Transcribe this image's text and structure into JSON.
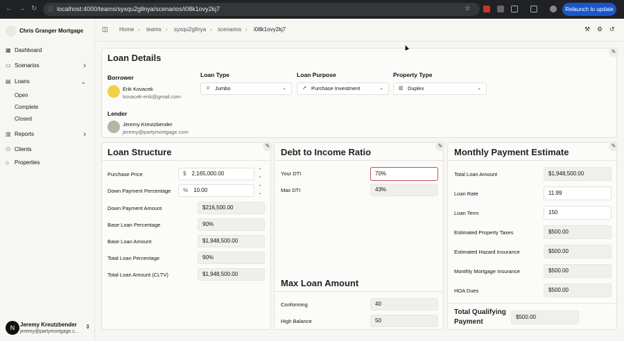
{
  "browser": {
    "url": "localhost:4000/teams/syxqu2gllnya/scenarios/i08k1ovy2kj7",
    "relaunch_label": "Relaunch to update"
  },
  "sidebar": {
    "org_name": "Chris Granger Mortgage",
    "items": [
      {
        "label": "Dashboard",
        "icon": "grid-icon"
      },
      {
        "label": "Scenarios",
        "icon": "file-icon"
      },
      {
        "label": "Loans",
        "icon": "document-icon"
      },
      {
        "label": "Reports",
        "icon": "chart-icon"
      },
      {
        "label": "Clients",
        "icon": "users-icon"
      },
      {
        "label": "Properties",
        "icon": "home-icon"
      }
    ],
    "loan_subitems": [
      "Open",
      "Complete",
      "Closed"
    ],
    "user": {
      "initial": "N",
      "name": "Jeremy Kreutzbender",
      "email": "jeremy@partymortgage.c..."
    }
  },
  "breadcrumb": [
    "Home",
    "teams",
    "syxqu2gllnya",
    "scenarios",
    "i08k1ovy2kj7"
  ],
  "loan_details": {
    "title": "Loan Details",
    "borrower_label": "Borrower",
    "borrower_name": "Erik Kovacek",
    "borrower_email": "kovacek-erik@gmail.com",
    "lender_label": "Lender",
    "lender_name": "Jeremy Kreutzbender",
    "lender_email": "jeremy@partymortgage.com",
    "loan_type_label": "Loan Type",
    "loan_type": "Jumbo",
    "loan_purpose_label": "Loan Purpose",
    "loan_purpose": "Purchase Investment",
    "property_type_label": "Property Type",
    "property_type": "Duplex"
  },
  "loan_structure": {
    "title": "Loan Structure",
    "purchase_price_label": "Purchase Price",
    "purchase_price_prefix": "$",
    "purchase_price": "2,165,000.00",
    "down_payment_pct_label": "Down Payment Percentage",
    "down_payment_pct_prefix": "%",
    "down_payment_pct": "10.00",
    "rows": [
      {
        "label": "Down Payment Amount",
        "value": "$216,500.00"
      },
      {
        "label": "Base Loan Percentage",
        "value": "90%"
      },
      {
        "label": "Base Loan Amount",
        "value": "$1,948,500.00"
      },
      {
        "label": "Total Loan Percentage",
        "value": "90%"
      },
      {
        "label": "Total Loan Amount (CLTV)",
        "value": "$1,948,500.00"
      }
    ]
  },
  "dti": {
    "title": "Debt to Income Ratio",
    "your_dti_label": "Your DTI",
    "your_dti": "70%",
    "max_dti_label": "Max DTI",
    "max_dti": "43%"
  },
  "max_loan": {
    "title": "Max Loan Amount",
    "conforming_label": "Conforming",
    "conforming": "40",
    "high_balance_label": "High Balance",
    "high_balance": "50"
  },
  "monthly": {
    "title": "Monthly Payment Estimate",
    "rows": [
      {
        "label": "Total Loan Amount",
        "value": "$1,948,500.00",
        "readonly": true
      },
      {
        "label": "Loan Rate",
        "value": "11.99",
        "readonly": false
      },
      {
        "label": "Loan Term",
        "value": "150",
        "readonly": false
      },
      {
        "label": "Estimated Property Taxes",
        "value": "$500.00",
        "readonly": true
      },
      {
        "label": "Estimated Hazard Insurance",
        "value": "$500.00",
        "readonly": true
      },
      {
        "label": "Monthly Mortgage Insurance",
        "value": "$500.00",
        "readonly": true
      },
      {
        "label": "HOA Dues",
        "value": "$500.00",
        "readonly": true
      }
    ],
    "total_label": "Total Qualifying Payment",
    "total_value": "$500.00"
  },
  "colors": {
    "error_border": "#c84b5a",
    "relaunch_bg": "#1a56c9"
  }
}
